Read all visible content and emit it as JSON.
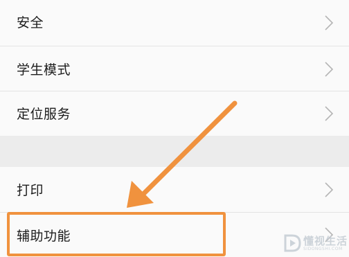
{
  "settings": {
    "items": [
      {
        "label": "安全",
        "icon": "chevron-right-icon"
      },
      {
        "label": "学生模式",
        "icon": "chevron-right-icon"
      },
      {
        "label": "定位服务",
        "icon": "chevron-right-icon"
      },
      {
        "label": "打印",
        "icon": "chevron-right-icon"
      },
      {
        "label": "辅助功能",
        "icon": "chevron-right-icon"
      }
    ]
  },
  "annotation": {
    "highlight_color": "#f0923e",
    "target": "辅助功能"
  },
  "watermark": {
    "text": "懂视生活",
    "sub": "SIDONGSHI.COM"
  },
  "colors": {
    "row_background": "#fafafa",
    "section_gap": "#ececec",
    "divider": "#e3e3e3",
    "chevron": "#b5b5b5",
    "text": "#1c1c1c"
  }
}
